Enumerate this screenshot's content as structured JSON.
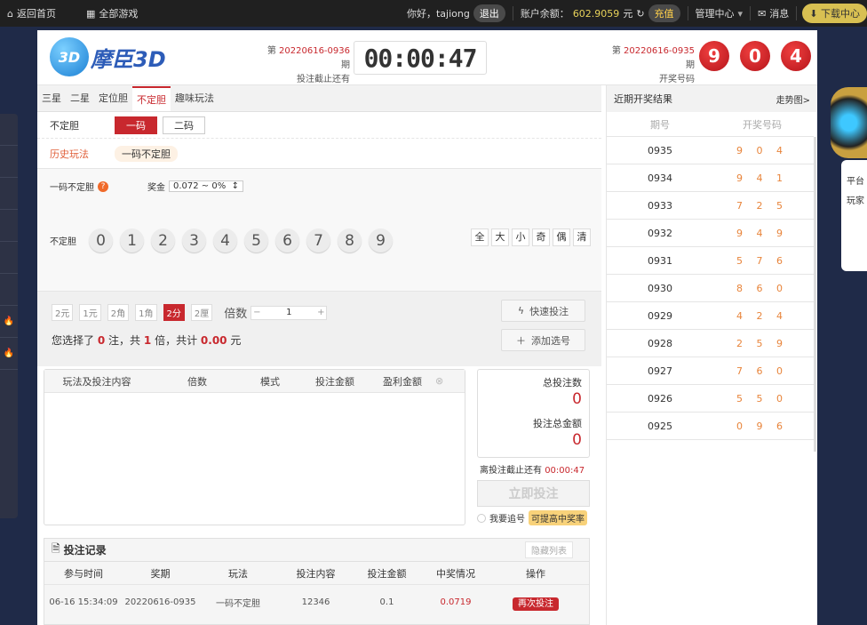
{
  "topbar": {
    "home": "返回首页",
    "all_games": "全部游戏",
    "greeting": "你好，tajiong",
    "logout": "退出",
    "balance_label": "账户余额：",
    "balance": "602.9059",
    "currency": "元",
    "recharge": "充值",
    "manage": "管理中心",
    "messages": "消息",
    "download": "下载中心"
  },
  "header": {
    "logo_ball": "3D",
    "logo_text": "摩臣3D",
    "current_issue_prefix": "第",
    "current_issue": "20220616-0936",
    "issue_suffix": "期",
    "deadline_label": "投注截止还有",
    "countdown": "00:00:47",
    "last_issue": "20220616-0935",
    "draw_label": "开奖号码",
    "draw_numbers": [
      "9",
      "0",
      "4"
    ]
  },
  "tabs": [
    "三星",
    "二星",
    "定位胆",
    "不定胆",
    "趣味玩法"
  ],
  "subplay": {
    "label": "不定胆",
    "options": [
      "一码",
      "二码"
    ]
  },
  "history": {
    "label": "历史玩法",
    "item": "一码不定胆"
  },
  "play": {
    "name": "一码不定胆",
    "prize_label": "奖金",
    "prize_value": "0.072 ~ 0%",
    "row_label": "不定胆",
    "numbers": [
      "0",
      "1",
      "2",
      "3",
      "4",
      "5",
      "6",
      "7",
      "8",
      "9"
    ],
    "quick": [
      "全",
      "大",
      "小",
      "奇",
      "偶",
      "清"
    ]
  },
  "bet": {
    "modes": [
      "2元",
      "1元",
      "2角",
      "1角",
      "2分",
      "2厘"
    ],
    "multiple_label": "倍数",
    "multiple": "1",
    "sel_prefix": "您选择了",
    "count": "0",
    "sel_mid1": "注，共",
    "times": "1",
    "sel_mid2": "倍，共计",
    "total": "0.00",
    "sel_suffix": "元",
    "quick_bet": "快速投注",
    "add": "添加选号"
  },
  "cart": {
    "headers": [
      "玩法及投注内容",
      "倍数",
      "模式",
      "投注金额",
      "盈利金额"
    ]
  },
  "summary": {
    "total_count_label": "总投注数",
    "total_count": "0",
    "total_amount_label": "投注总金额",
    "total_amount": "0",
    "deadline_label": "离投注截止还有",
    "deadline": "00:00:47",
    "submit": "立即投注",
    "chase": "我要追号",
    "chase_tip": "可提高中奖率"
  },
  "records": {
    "title": "投注记录",
    "hide": "隐藏列表",
    "headers": [
      "参与时间",
      "奖期",
      "玩法",
      "投注内容",
      "投注金额",
      "中奖情况",
      "操作"
    ],
    "rows": [
      {
        "time": "06-16 15:34:09",
        "issue": "20220616-0935",
        "play": "一码不定胆",
        "content": "12346",
        "amount": "0.1",
        "win": "0.0719",
        "action": "再次投注"
      }
    ]
  },
  "recent": {
    "title": "近期开奖结果",
    "trend": "走势图>",
    "col_issue": "期号",
    "col_num": "开奖号码",
    "rows": [
      [
        "0935",
        "9 0 4"
      ],
      [
        "0934",
        "9 4 1"
      ],
      [
        "0933",
        "7 2 5"
      ],
      [
        "0932",
        "9 4 9"
      ],
      [
        "0931",
        "5 7 6"
      ],
      [
        "0930",
        "8 6 0"
      ],
      [
        "0929",
        "4 2 4"
      ],
      [
        "0928",
        "2 5 9"
      ],
      [
        "0927",
        "7 6 0"
      ],
      [
        "0926",
        "5 5 0"
      ],
      [
        "0925",
        "0 9 6"
      ]
    ]
  },
  "side": {
    "items": [
      "平台",
      "玩家"
    ]
  }
}
